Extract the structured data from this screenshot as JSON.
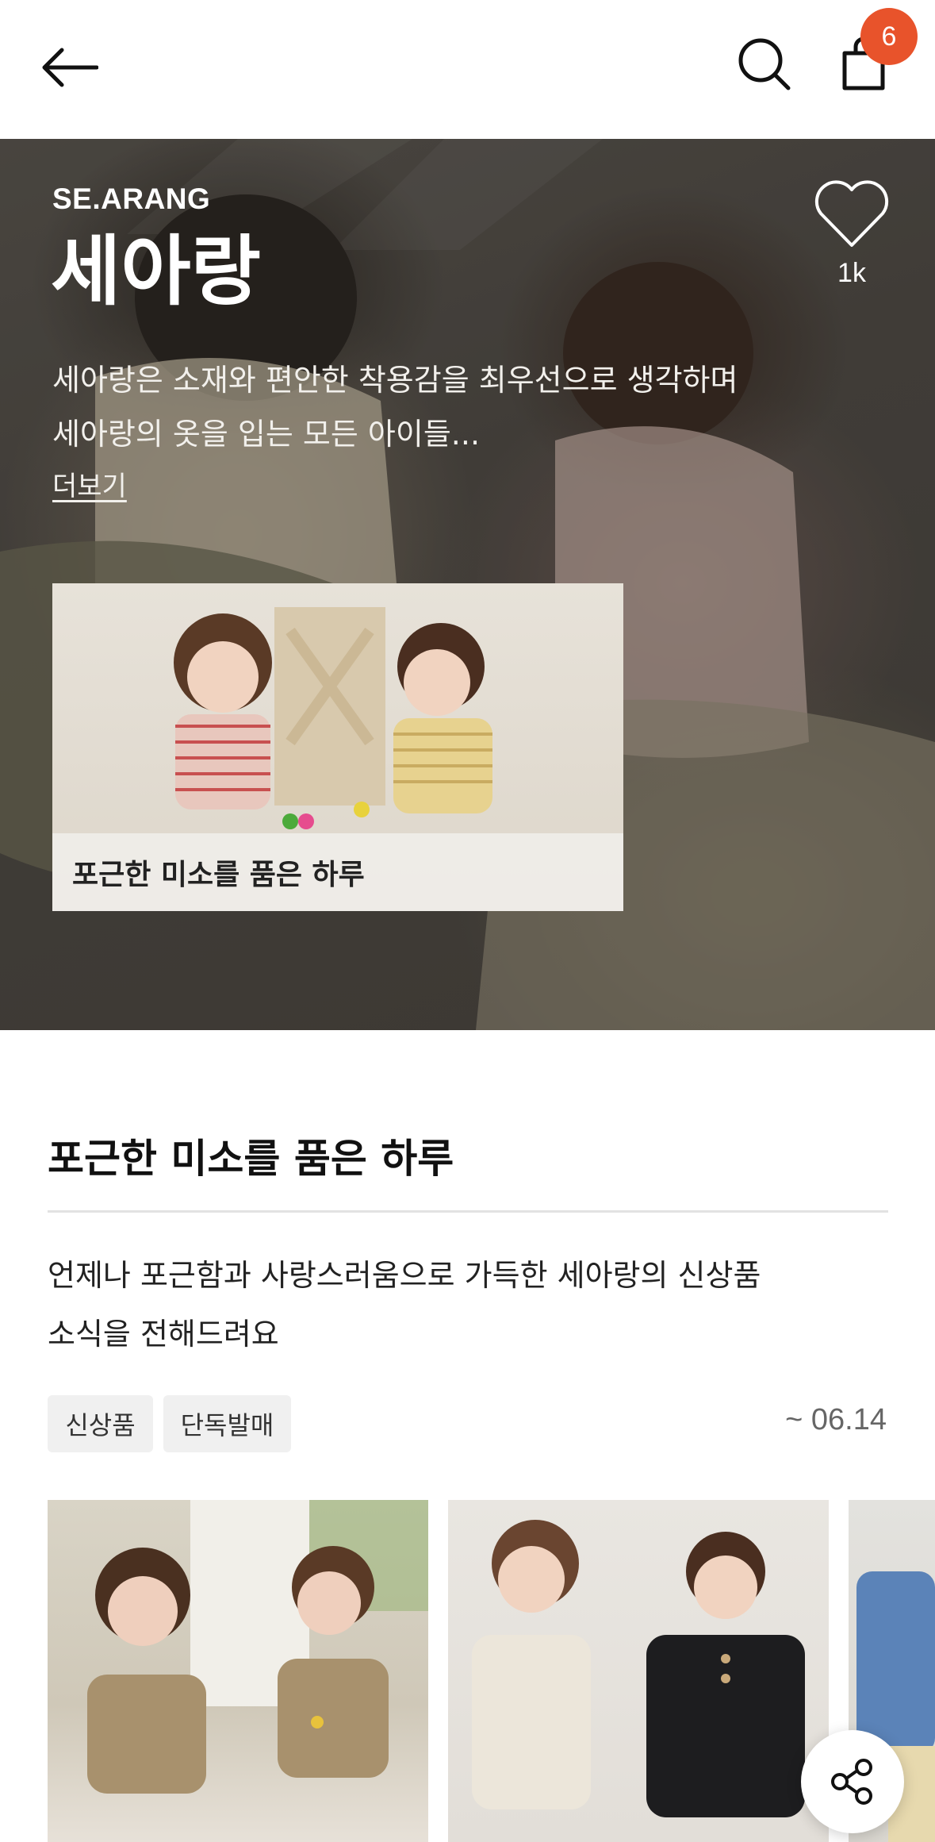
{
  "header": {
    "back_icon": "arrow-left-icon",
    "search_icon": "search-icon",
    "bag_icon": "shopping-bag-icon",
    "cart_count": "6",
    "badge_color": "#e8532b"
  },
  "hero": {
    "brand_en": "SE.ARANG",
    "brand_ko": "세아랑",
    "description_line1": "세아랑은 소재와 편안한 착용감을 최우선으로 생각하며",
    "description_line2": "세아랑의 옷을 입는 모든 아이들...",
    "more_label": "더보기",
    "like_icon": "heart-outline-icon",
    "like_count": "1k",
    "feature_caption": "포근한 미소를 품은 하루"
  },
  "section": {
    "title": "포근한 미소를 품은 하루",
    "description_line1": "언제나 포근함과 사랑스러움으로 가득한 세아랑의 신상품",
    "description_line2": "소식을 전해드려요",
    "tags": [
      "신상품",
      "단독발매"
    ],
    "period": "~ 06.14"
  },
  "floating": {
    "share_icon": "share-icon"
  }
}
